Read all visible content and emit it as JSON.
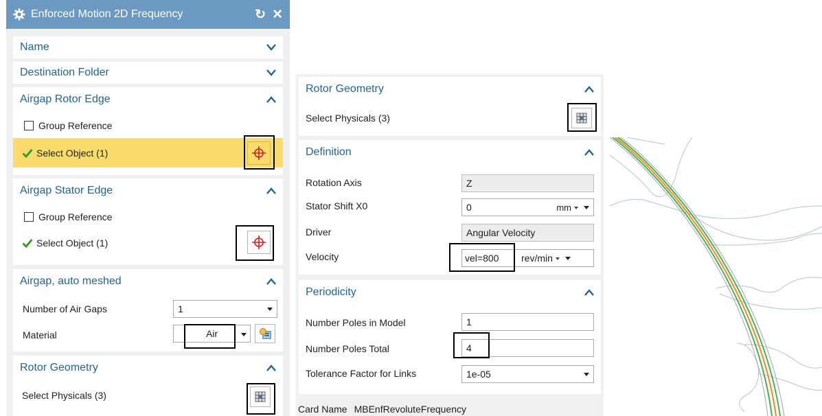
{
  "dialog": {
    "title": "Enforced Motion 2D Frequency",
    "title_icons": [
      "gear-icon",
      "reset-icon",
      "close-icon"
    ],
    "close_glyph": "✕",
    "reset_glyph": "↻"
  },
  "name_group": {
    "title": "Name"
  },
  "destination_group": {
    "title": "Destination Folder"
  },
  "rotor_edge_group": {
    "title": "Airgap Rotor Edge",
    "group_reference": "Group Reference",
    "select_object": "Select Object (1)"
  },
  "stator_edge_group": {
    "title": "Airgap Stator Edge",
    "group_reference": "Group Reference",
    "select_object": "Select Object (1)"
  },
  "airgap_group": {
    "title": "Airgap, auto meshed",
    "num_air_gaps_label": "Number of Air Gaps",
    "num_air_gaps_value": "1",
    "material_label": "Material",
    "material_value": "Air"
  },
  "rotor_geometry_left": {
    "title": "Rotor Geometry",
    "select_physicals": "Select Physicals (3)"
  },
  "rotor_geometry_right": {
    "title": "Rotor Geometry",
    "select_physicals": "Select Physicals (3)"
  },
  "definition": {
    "title": "Definition",
    "rotation_axis_label": "Rotation Axis",
    "rotation_axis_value": "Z",
    "stator_shift_label": "Stator Shift X0",
    "stator_shift_value": "0",
    "stator_shift_unit": "mm",
    "driver_label": "Driver",
    "driver_value": "Angular Velocity",
    "velocity_label": "Velocity",
    "velocity_value": "vel=800",
    "velocity_unit": "rev/min"
  },
  "periodicity": {
    "title": "Periodicity",
    "poles_model_label": "Number Poles in Model",
    "poles_model_value": "1",
    "poles_total_label": "Number Poles Total",
    "poles_total_value": "4",
    "tolerance_label": "Tolerance Factor for Links",
    "tolerance_value": "1e-05"
  },
  "card": {
    "label": "Card Name",
    "value": "MBEnfRevoluteFrequency"
  },
  "colors": {
    "title_bar": "#6b99c1",
    "group_title": "#1f6596",
    "selection_highlight": "#f9dc6b",
    "check_green": "#3a9b2c",
    "crosshair_red": "#d01f1f",
    "airgap_orange": "#f08a24",
    "airgap_green": "#4caf50"
  }
}
